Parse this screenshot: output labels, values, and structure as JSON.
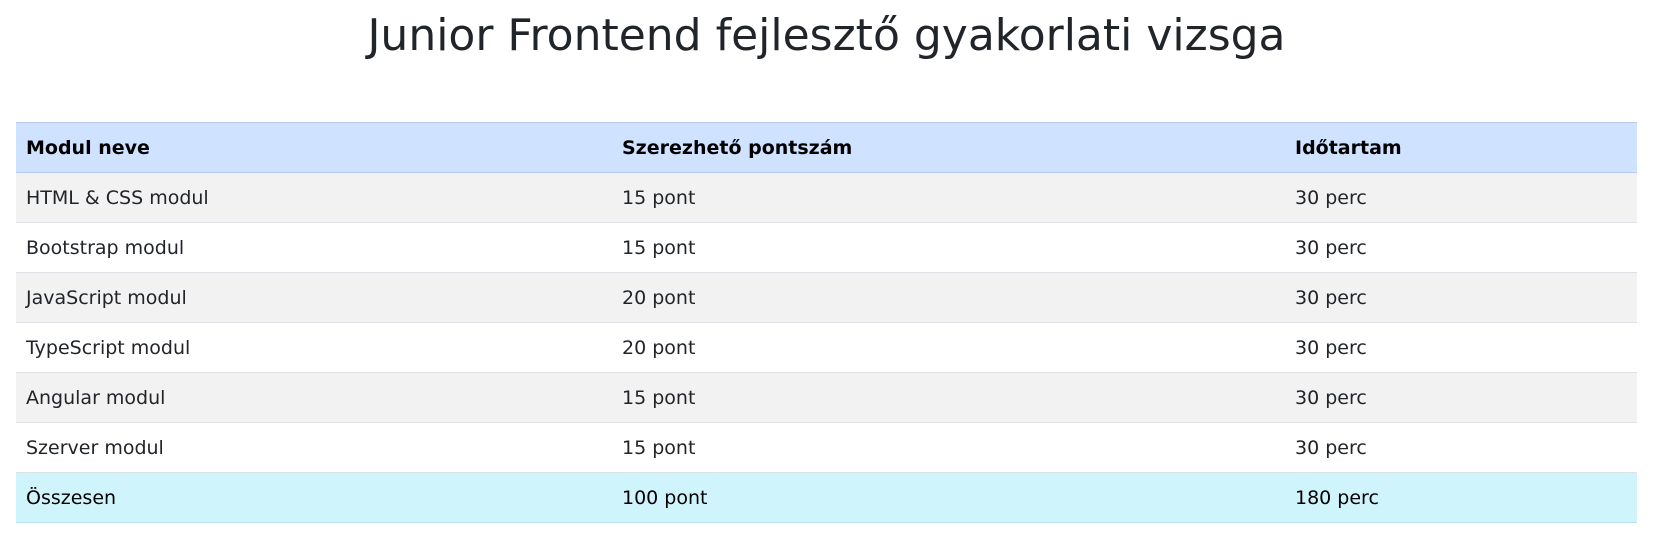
{
  "page": {
    "title": "Junior Frontend fejlesztő gyakorlati vizsga"
  },
  "table": {
    "headers": [
      "Modul neve",
      "Szerezhető pontszám",
      "Időtartam"
    ],
    "rows": [
      [
        "HTML & CSS modul",
        "15 pont",
        "30 perc"
      ],
      [
        "Bootstrap modul",
        "15 pont",
        "30 perc"
      ],
      [
        "JavaScript modul",
        "20 pont",
        "30 perc"
      ],
      [
        "TypeScript modul",
        "20 pont",
        "30 perc"
      ],
      [
        "Angular modul",
        "15 pont",
        "30 perc"
      ],
      [
        "Szerver modul",
        "15 pont",
        "30 perc"
      ]
    ],
    "total": [
      "Összesen",
      "100 pont",
      "180 perc"
    ]
  },
  "colors": {
    "header_bg": "#cfe2ff",
    "striped_bg": "#f2f2f2",
    "total_bg": "#cff4fc"
  }
}
